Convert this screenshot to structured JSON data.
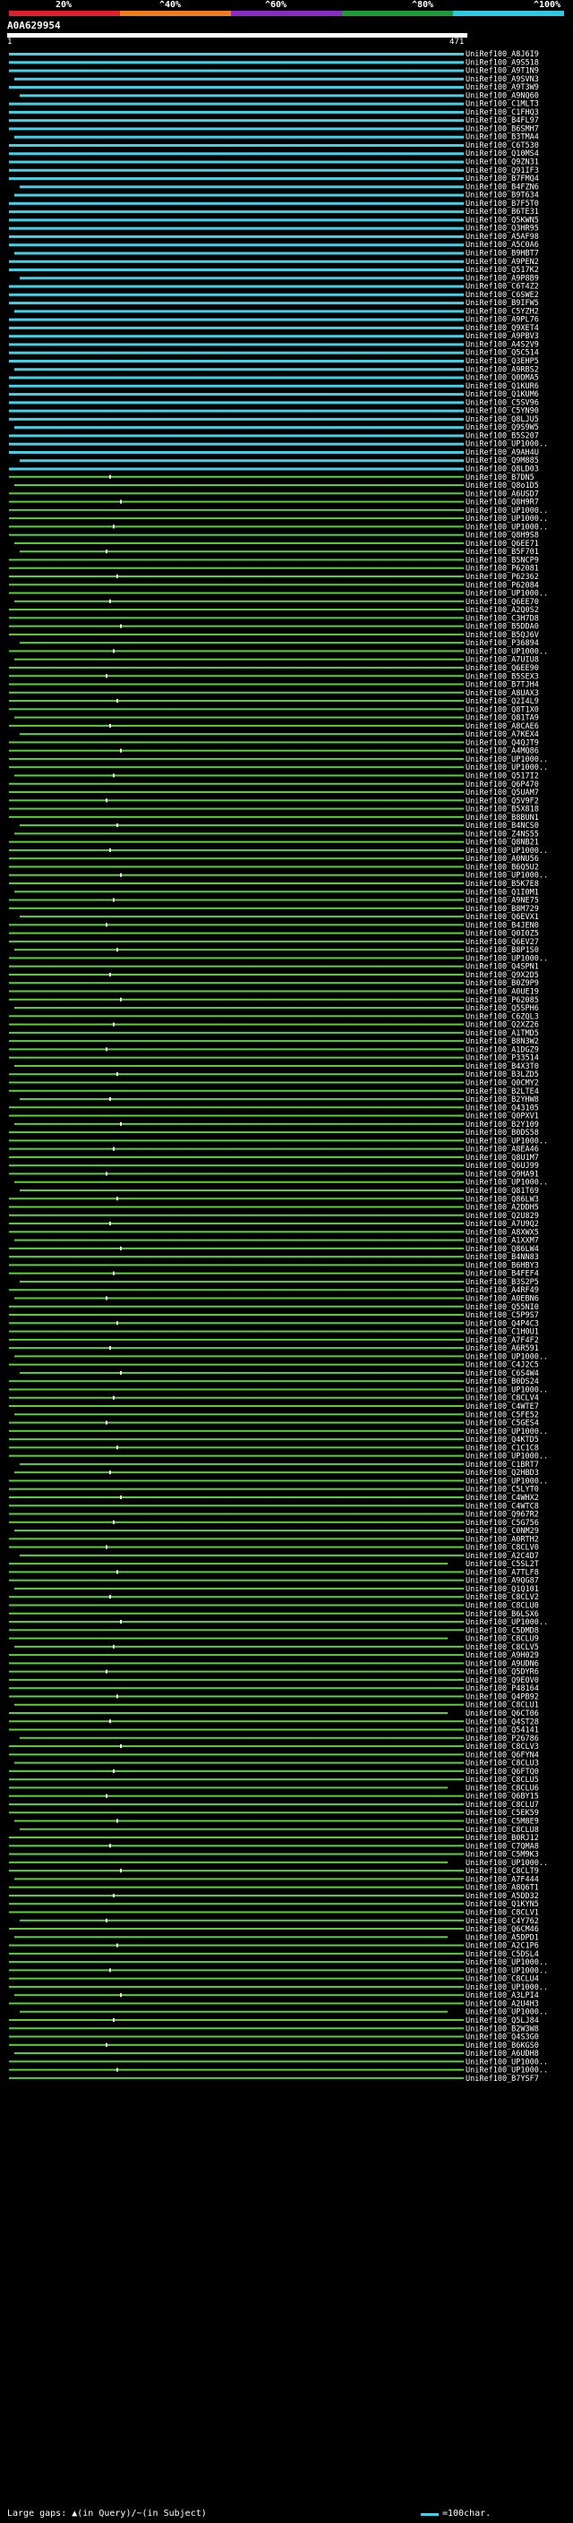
{
  "header": {
    "scale_labels": [
      "20%",
      "^40%",
      "^60%",
      "^80%",
      "^100%"
    ],
    "scale_colors": [
      "#e0202a",
      "#f07e1e",
      "#8a2bc6",
      "#1e9a3a",
      "#2ec8e0"
    ]
  },
  "query": {
    "name": "A0A629954",
    "start": "1",
    "end": "471"
  },
  "colors": {
    "high": "#46d0e6",
    "mid": "#5bd03a",
    "line": "#5bd03a"
  },
  "hits": [
    "UniRef100_A8J6I9",
    "UniRef100_A9S518",
    "UniRef100_A9T1N9",
    "UniRef100_A9SVN3",
    "UniRef100_A9T3W9",
    "UniRef100_A9NQ60",
    "UniRef100_C1MLT3",
    "UniRef100_C1FHQ3",
    "UniRef100_B4FL97",
    "UniRef100_B6SMH7",
    "UniRef100_B3TMA4",
    "UniRef100_C6T530",
    "UniRef100_Q10MS4",
    "UniRef100_Q9ZN31",
    "UniRef100_Q91IF3",
    "UniRef100_B7FMQ4",
    "UniRef100_B4FZN6",
    "UniRef100_B9T634",
    "UniRef100_B7F5T0",
    "UniRef100_B6TE31",
    "UniRef100_Q5KWN5",
    "UniRef100_Q3HR95",
    "UniRef100_A5AF98",
    "UniRef100_A5C0A6",
    "UniRef100_B9HBT7",
    "UniRef100_A9PEN2",
    "UniRef100_Q517K2",
    "UniRef100_A9P8B9",
    "UniRef100_C6T4Z2",
    "UniRef100_C6SWE2",
    "UniRef100_B9IFW5",
    "UniRef100_C5YZH2",
    "UniRef100_A9PL76",
    "UniRef100_Q9XET4",
    "UniRef100_A9PBV3",
    "UniRef100_A4S2V9",
    "UniRef100_Q5C514",
    "UniRef100_Q3EHP5",
    "UniRef100_A9RBS2",
    "UniRef100_Q0DMA5",
    "UniRef100_Q1KUR6",
    "UniRef100_Q1KUM6",
    "UniRef100_C5SV96",
    "UniRef100_C5YN90",
    "UniRef100_Q8LJU5",
    "UniRef100_Q9S9W5",
    "UniRef100_B5S207",
    "UniRef100_UP1000..",
    "UniRef100_A9AH4U",
    "UniRef100_Q9M885",
    "UniRef100_Q8LD03",
    "UniRef100_B7DN5",
    "UniRef100_Q8o1D5",
    "UniRef100_A6USD7",
    "UniRef100_Q8H9R7",
    "UniRef100_UP1000..",
    "UniRef100_UP1000..",
    "UniRef100_UP1000..",
    "UniRef100_Q8H9S8",
    "UniRef100_Q6EE71",
    "UniRef100_B5F701",
    "UniRef100_B5NCP9",
    "UniRef100_P62081",
    "UniRef100_P62362",
    "UniRef100_P62084",
    "UniRef100_UP1000..",
    "UniRef100_Q6EE70",
    "UniRef100_A2Q0S2",
    "UniRef100_C3H7D8",
    "UniRef100_B5DDA0",
    "UniRef100_B5QJ6V",
    "UniRef100_P36894",
    "UniRef100_UP1000..",
    "UniRef100_A7UIU8",
    "UniRef100_Q6EE90",
    "UniRef100_B5SEX3",
    "UniRef100_B7TJH4",
    "UniRef100_A8UAX3",
    "UniRef100_Q2I4L9",
    "UniRef100_Q8T1X0",
    "UniRef100_Q81TA9",
    "UniRef100_A8CAE6",
    "UniRef100_A7KEX4",
    "UniRef100_Q4QJT9",
    "UniRef100_A4MQ86",
    "UniRef100_UP1000..",
    "UniRef100_UP1000..",
    "UniRef100_Q517I2",
    "UniRef100_Q6P470",
    "UniRef100_Q5UAM7",
    "UniRef100_Q5V9F2",
    "UniRef100_B5X818",
    "UniRef100_B8BUN1",
    "UniRef100_B4NCS0",
    "UniRef100_Z4NS55",
    "UniRef100_Q8NB21",
    "UniRef100_UP1000..",
    "UniRef100_A0NU56",
    "UniRef100_B6Q5U2",
    "UniRef100_UP1000..",
    "UniRef100_B5K7E8",
    "UniRef100_Q1I0M1",
    "UniRef100_A9NE75",
    "UniRef100_B8M729",
    "UniRef100_Q6EVX1",
    "UniRef100_B4JEN0",
    "UniRef100_Q0I0Z5",
    "UniRef100_Q6EV27",
    "UniRef100_B8P1S0",
    "UniRef100_UP1000..",
    "UniRef100_Q4SPN1",
    "UniRef100_Q9X2D5",
    "UniRef100_B0Z9P9",
    "UniRef100_A0UE19",
    "UniRef100_P62085",
    "UniRef100_Q5SPH6",
    "UniRef100_C6ZQL3",
    "UniRef100_Q2XZ26",
    "UniRef100_A1TMD5",
    "UniRef100_B8N3W2",
    "UniRef100_A1DGZ9",
    "UniRef100_P33514",
    "UniRef100_B4X3T0",
    "UniRef100_B3LZD5",
    "UniRef100_Q0CMY2",
    "UniRef100_B2LTE4",
    "UniRef100_B2YHW8",
    "UniRef100_Q43105",
    "UniRef100_Q0PXV1",
    "UniRef100_B2Y109",
    "UniRef100_B0DS58",
    "UniRef100_UP1000..",
    "UniRef100_A8EA46",
    "UniRef100_Q8U1M7",
    "UniRef100_Q6UJ99",
    "UniRef100_Q9HA91",
    "UniRef100_UP1000..",
    "UniRef100_Q81T69",
    "UniRef100_Q86LW3",
    "UniRef100_A2DDH5",
    "UniRef100_Q2U829",
    "UniRef100_A7U9Q2",
    "UniRef100_A8XWX5",
    "UniRef100_A1XXM7",
    "UniRef100_Q86LW4",
    "UniRef100_B4NN83",
    "UniRef100_B6HBY3",
    "UniRef100_B4FEF4",
    "UniRef100_B3S2P5",
    "UniRef100_A4RF49",
    "UniRef100_A0EBN6",
    "UniRef100_Q55NI0",
    "UniRef100_C5P9S7",
    "UniRef100_Q4P4C3",
    "UniRef100_C1H0U1",
    "UniRef100_A7F4F2",
    "UniRef100_A6R591",
    "UniRef100_UP1000..",
    "UniRef100_C4J2C5",
    "UniRef100_C6S4W4",
    "UniRef100_B0DS24",
    "UniRef100_UP1000..",
    "UniRef100_C8CLV4",
    "UniRef100_C4WTE7",
    "UniRef100_C5FE52",
    "UniRef100_C5GES4",
    "UniRef100_UP1000..",
    "UniRef100_Q4KTD5",
    "UniRef100_C1C1C8",
    "UniRef100_UP1000..",
    "UniRef100_C1BRT7",
    "UniRef100_Q2HBD3",
    "UniRef100_UP1000..",
    "UniRef100_C5LYT0",
    "UniRef100_C4WHX2",
    "UniRef100_C4WTC8",
    "UniRef100_Q967R2",
    "UniRef100_C5G756",
    "UniRef100_C0NM29",
    "UniRef100_A0RTH2",
    "UniRef100_C8CLV0",
    "UniRef100_A2C4D7",
    "UniRef100_C5SL2T",
    "UniRef100_A7TLF8",
    "UniRef100_A9QG87",
    "UniRef100_Q1Q101",
    "UniRef100_C8CLV2",
    "UniRef100_C8CLU0",
    "UniRef100_B6LSX6",
    "UniRef100_UP1000..",
    "UniRef100_C5DMD8",
    "UniRef100_C8CLU9",
    "UniRef100_C8CLV5",
    "UniRef100_A9H029",
    "UniRef100_A9UDN6",
    "UniRef100_Q5DYR6",
    "UniRef100_Q9EOV0",
    "UniRef100_P48164",
    "UniRef100_Q4PB92",
    "UniRef100_C8CLU1",
    "UniRef100_Q6CT06",
    "UniRef100_Q4ST28",
    "UniRef100_Q54141",
    "UniRef100_P26786",
    "UniRef100_C8CLV3",
    "UniRef100_Q6FYN4",
    "UniRef100_C8CLU3",
    "UniRef100_Q6FTQ0",
    "UniRef100_C8CLU5",
    "UniRef100_C8CLU6",
    "UniRef100_Q6BY15",
    "UniRef100_C8CLU7",
    "UniRef100_C5EK59",
    "UniRef100_C5M8E9",
    "UniRef100_C8CLU8",
    "UniRef100_B0RJ12",
    "UniRef100_C7QMA8",
    "UniRef100_C5M9K3",
    "UniRef100_UP1000..",
    "UniRef100_C8CLT9",
    "UniRef100_A7F444",
    "UniRef100_A8Q6T1",
    "UniRef100_A5DD32",
    "UniRef100_Q1KYN5",
    "UniRef100_C8CLV1",
    "UniRef100_C4Y762",
    "UniRef100_Q6CM46",
    "UniRef100_A5DPD1",
    "UniRef100_A2C1P6",
    "UniRef100_C5DSL4",
    "UniRef100_UP1000..",
    "UniRef100_UP1000..",
    "UniRef100_C8CLU4",
    "UniRef100_UP1000..",
    "UniRef100_A3LPI4",
    "UniRef100_A2U4H3",
    "UniRef100_UP1000..",
    "UniRef100_Q5LJ84",
    "UniRef100_B2W3W8",
    "UniRef100_Q4S3G0",
    "UniRef100_B6KGS0",
    "UniRef100_A6UDH8",
    "UniRef100_UP1000..",
    "UniRef100_UP1000..",
    "UniRef100_B7YSF7"
  ]
}
